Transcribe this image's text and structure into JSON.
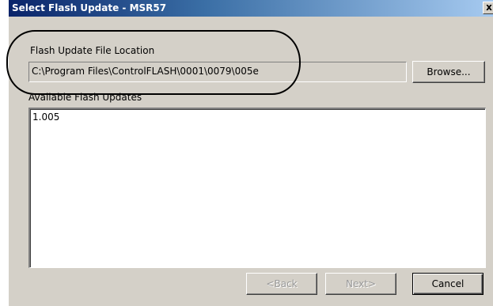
{
  "window": {
    "title": "Select Flash Update - MSR57",
    "close_glyph": "x"
  },
  "location": {
    "label": "Flash Update File Location",
    "path": "C:\\Program Files\\ControlFLASH\\0001\\0079\\005e",
    "browse_label": "Browse..."
  },
  "updates": {
    "label": "Available Flash Updates",
    "items": [
      "1.005"
    ]
  },
  "footer": {
    "back_label": "<Back",
    "next_label": "Next>",
    "cancel_label": "Cancel"
  },
  "colors": {
    "dialog_bg": "#d4d0c8",
    "title_start": "#0a246a",
    "title_end": "#a6caf0",
    "disabled_text": "#9a9a9a"
  }
}
